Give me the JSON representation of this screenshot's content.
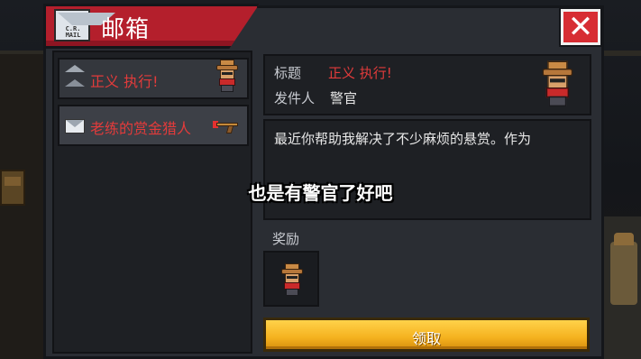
{
  "window": {
    "title": "邮箱",
    "logo_text": "C.R. MAIL",
    "close_label": "✕"
  },
  "mail_list": [
    {
      "subject": "正义 执行!",
      "read": true,
      "icon": "cowboy-avatar"
    },
    {
      "subject": "老练的赏金猎人",
      "read": false,
      "icon": "revolver-icon"
    }
  ],
  "detail": {
    "title_label": "标题",
    "title_value": "正义 执行!",
    "sender_label": "发件人",
    "sender_value": "警官",
    "body": "最近你帮助我解决了不少麻烦的悬赏。作为",
    "reward_label": "奖励",
    "claim_label": "领取"
  },
  "subtitle": "也是有警官了好吧",
  "colors": {
    "accent_red": "#b41f2c",
    "close_red": "#d72d33",
    "claim_yellow": "#f5b21f",
    "text_red": "#e23b3b"
  }
}
